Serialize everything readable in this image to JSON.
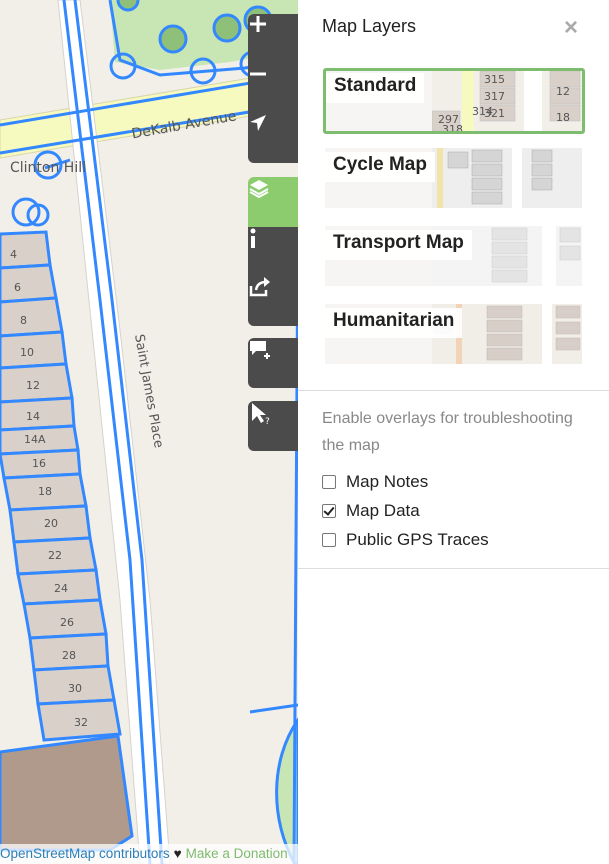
{
  "map": {
    "street_labels": [
      "DeKalb Avenue",
      "Saint James Place",
      "Clinton Hill"
    ],
    "house_numbers": [
      "4",
      "6",
      "8",
      "10",
      "12",
      "14",
      "14A",
      "16",
      "18",
      "20",
      "22",
      "24",
      "26",
      "28",
      "30",
      "32"
    ],
    "attribution": {
      "contributors": "OpenStreetMap contributors",
      "heart": "♥",
      "donate": "Make a Donation"
    }
  },
  "toolbar": {
    "zoom_in": "plus-icon",
    "zoom_out": "minus-icon",
    "locate": "navigation-arrow-icon",
    "layers": "layers-icon",
    "info": "info-icon",
    "share": "share-icon",
    "add_note": "add-note-icon",
    "query": "query-cursor-icon"
  },
  "panel": {
    "title": "Map Layers",
    "close": "×",
    "layers": [
      {
        "label": "Standard",
        "selected": true
      },
      {
        "label": "Cycle Map",
        "selected": false
      },
      {
        "label": "Transport Map",
        "selected": false
      },
      {
        "label": "Humanitarian",
        "selected": false
      }
    ],
    "overlay_description": "Enable overlays for troubleshooting the map",
    "overlays": [
      {
        "label": "Map Notes",
        "checked": false
      },
      {
        "label": "Map Data",
        "checked": true
      },
      {
        "label": "Public GPS Traces",
        "checked": false
      }
    ]
  },
  "colors": {
    "accent": "#7ebc6f",
    "toolbar": "#4b4b4b",
    "data_line": "#3388ff"
  }
}
